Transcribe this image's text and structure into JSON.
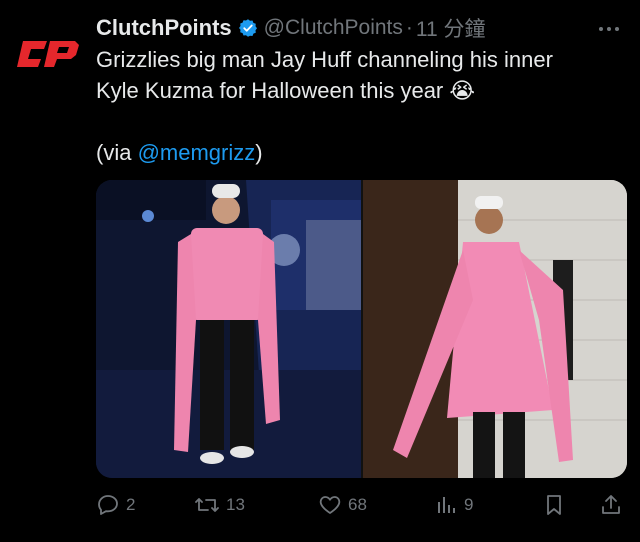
{
  "tweet": {
    "display_name": "ClutchPoints",
    "verified": true,
    "handle": "@ClutchPoints",
    "separator": "·",
    "time": "11 分鐘",
    "more_icon": "more-icon",
    "avatar_text": "CP",
    "text_line1": "Grizzlies big man Jay Huff channeling his inner",
    "text_line2": "Kyle Kuzma for Halloween this year",
    "emoji": "😭",
    "via_prefix": "(via ",
    "via_mention": "@memgrizz",
    "via_suffix": ")",
    "mention_color": "#1d9bf0"
  },
  "actions": {
    "reply_count": "2",
    "retweet_count": "13",
    "like_count": "68",
    "views_count": "9"
  },
  "colors": {
    "background": "#000000",
    "text": "#e7e9ea",
    "muted": "#71767b",
    "verified": "#1d9bf0",
    "brand_red": "#e5272c"
  }
}
